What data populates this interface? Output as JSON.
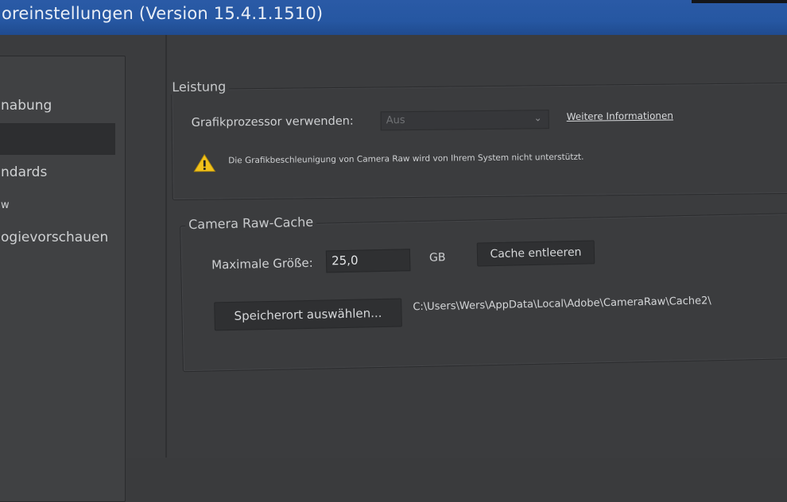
{
  "titlebar": {
    "title": "oreinstellungen  (Version 15.4.1.1510)"
  },
  "sidebar": {
    "items": [
      {
        "label": "nabung"
      },
      {
        "label": ""
      },
      {
        "label": "ndards"
      },
      {
        "label": "w"
      },
      {
        "label": "ogievorschauen"
      }
    ]
  },
  "leistung": {
    "legend": "Leistung",
    "gpu_label": "Grafikprozessor verwenden:",
    "gpu_select_value": "Aus",
    "more_info_link": "Weitere Informationen",
    "warning_text": "Die Grafikbeschleunigung von Camera Raw wird von Ihrem System nicht unterstützt."
  },
  "cache": {
    "legend": "Camera Raw-Cache",
    "max_size_label": "Maximale Größe:",
    "max_size_value": "25,0",
    "unit": "GB",
    "clear_button": "Cache entleeren",
    "choose_location_button": "Speicherort auswählen...",
    "path": "C:\\Users\\Wers\\AppData\\Local\\Adobe\\CameraRaw\\Cache2\\"
  },
  "colors": {
    "titlebar": "#2657a2",
    "background": "#3b3c3e",
    "warning_yellow": "#f2c21a"
  }
}
